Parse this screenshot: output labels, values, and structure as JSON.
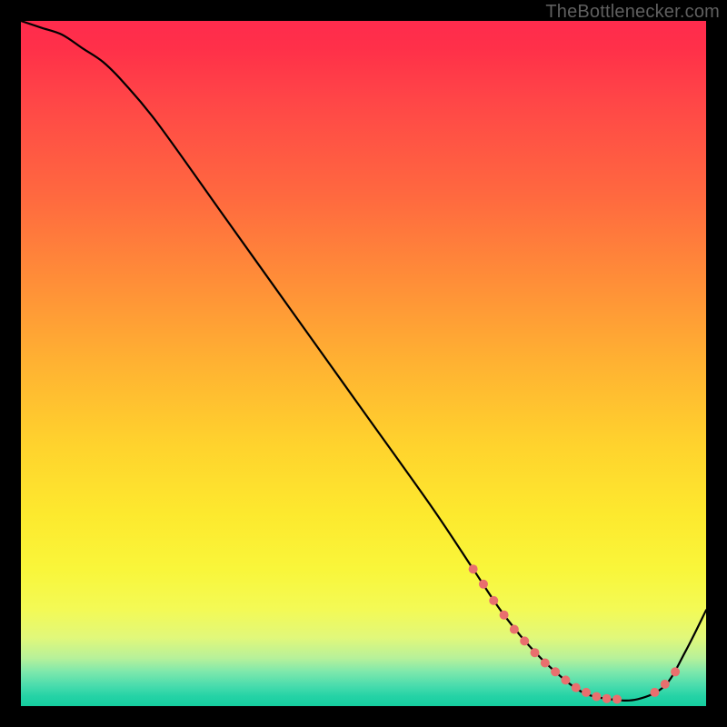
{
  "watermark": {
    "text": "TheBottlenecker.com"
  },
  "chart_data": {
    "type": "line",
    "title": "",
    "xlabel": "",
    "ylabel": "",
    "xlim": [
      0,
      100
    ],
    "ylim": [
      0,
      100
    ],
    "grid": false,
    "legend": false,
    "background_gradient": {
      "orientation": "vertical",
      "stops": [
        {
          "pos": 0.0,
          "color": "#ff2b4d"
        },
        {
          "pos": 0.5,
          "color": "#ffd32d"
        },
        {
          "pos": 0.8,
          "color": "#f9f63a"
        },
        {
          "pos": 1.0,
          "color": "#14cd9f"
        }
      ]
    },
    "series": [
      {
        "name": "bottleneck-curve",
        "color": "#000000",
        "x": [
          0,
          3,
          6,
          9,
          12,
          15,
          20,
          30,
          40,
          50,
          60,
          66,
          70,
          74,
          78,
          82,
          86,
          90,
          94,
          97,
          100
        ],
        "values": [
          100,
          99,
          98,
          96,
          94,
          91,
          85,
          71,
          57,
          43,
          29,
          20,
          14,
          9,
          5,
          2,
          1,
          1,
          3,
          8,
          14
        ]
      }
    ],
    "markers": {
      "name": "highlight-dots",
      "color": "#e96f6e",
      "radius_px": 5,
      "points": [
        {
          "x": 66.0,
          "y": 20.0
        },
        {
          "x": 67.5,
          "y": 17.8
        },
        {
          "x": 69.0,
          "y": 15.4
        },
        {
          "x": 70.5,
          "y": 13.3
        },
        {
          "x": 72.0,
          "y": 11.2
        },
        {
          "x": 73.5,
          "y": 9.5
        },
        {
          "x": 75.0,
          "y": 7.8
        },
        {
          "x": 76.5,
          "y": 6.3
        },
        {
          "x": 78.0,
          "y": 5.0
        },
        {
          "x": 79.5,
          "y": 3.8
        },
        {
          "x": 81.0,
          "y": 2.7
        },
        {
          "x": 82.5,
          "y": 2.0
        },
        {
          "x": 84.0,
          "y": 1.4
        },
        {
          "x": 85.5,
          "y": 1.1
        },
        {
          "x": 87.0,
          "y": 1.0
        },
        {
          "x": 92.5,
          "y": 2.0
        },
        {
          "x": 94.0,
          "y": 3.2
        },
        {
          "x": 95.5,
          "y": 5.0
        }
      ]
    }
  }
}
